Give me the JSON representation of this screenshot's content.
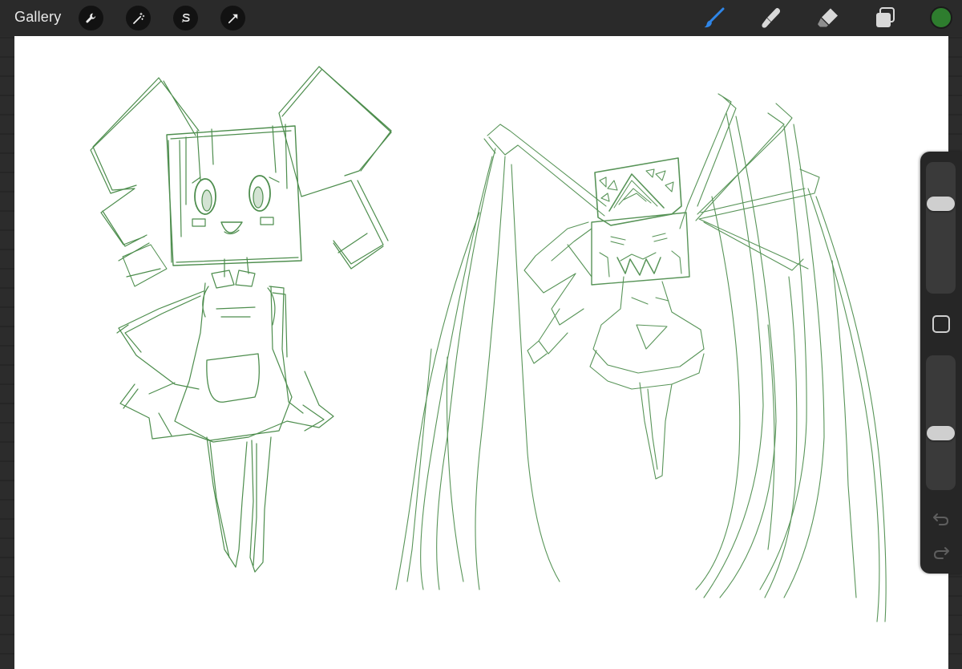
{
  "topbar": {
    "gallery_label": "Gallery",
    "left_tools": [
      {
        "name": "actions",
        "icon": "wrench-icon"
      },
      {
        "name": "adjustments",
        "icon": "magic-wand-icon"
      },
      {
        "name": "selection",
        "icon": "selection-s-icon"
      },
      {
        "name": "transform",
        "icon": "arrow-cursor-icon"
      }
    ],
    "right_tools": [
      {
        "name": "brush",
        "icon": "brush-icon",
        "active": true
      },
      {
        "name": "smudge",
        "icon": "smudge-finger-icon",
        "active": false
      },
      {
        "name": "eraser",
        "icon": "eraser-icon",
        "active": false
      },
      {
        "name": "layers",
        "icon": "layers-icon",
        "active": false
      }
    ],
    "current_color": "#2e7d2e"
  },
  "colors": {
    "accent_active_tool": "#2f86e8",
    "sketch_stroke": "#2f7a2f",
    "frame": "#2a2a2a"
  },
  "sidebar": {
    "brush_size_level": 0.75,
    "opacity_level": 0.4,
    "modify_icon": "square-modify-icon",
    "undo_icon": "undo-arrow-icon",
    "redo_icon": "redo-arrow-icon"
  }
}
